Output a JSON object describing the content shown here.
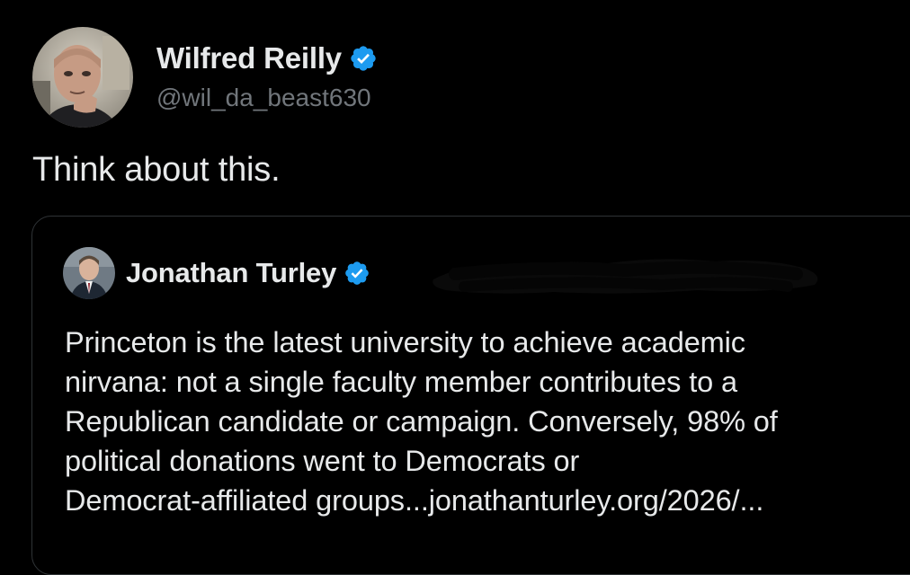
{
  "post": {
    "author": {
      "display_name": "Wilfred Reilly",
      "handle": "@wil_da_beast630",
      "verified": true,
      "avatar_icon": "user-avatar-photo"
    },
    "text": "Think about this."
  },
  "quoted_post": {
    "author": {
      "display_name": "Jonathan Turley",
      "verified": true,
      "avatar_icon": "user-avatar-photo"
    },
    "text_lines": [
      "Princeton is the latest university to achieve academic",
      "nirvana: not a single faculty member contributes to a",
      "Republican candidate or campaign. Conversely, 98% of",
      "political donations went to Democrats or",
      "Democrat-affiliated groups...jonathanturley.org/2026/..."
    ]
  },
  "colors": {
    "background": "#000000",
    "text_primary": "#e7e9ea",
    "text_secondary": "#71767b",
    "verified_badge": "#1d9bf0",
    "border": "#2f3336"
  }
}
